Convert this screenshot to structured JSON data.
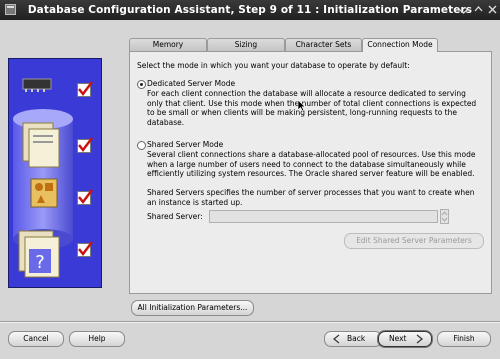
{
  "window": {
    "title": "Database Configuration Assistant, Step 9 of 11 : Initialization Parameters",
    "controls": [
      "minimize",
      "maximize",
      "close"
    ]
  },
  "tabs": [
    {
      "label": "Memory",
      "active": false
    },
    {
      "label": "Sizing",
      "active": false
    },
    {
      "label": "Character Sets",
      "active": false
    },
    {
      "label": "Connection Mode",
      "active": true
    }
  ],
  "content": {
    "intro": "Select the mode in which you want your database to operate by default:",
    "dedicated": {
      "label": "Dedicated Server Mode",
      "selected": true,
      "desc": [
        "For each client connection the database will allocate a resource dedicated to serving",
        "only that client.  Use this mode when the number of total client connections is expected",
        "to be small or when clients will be making persistent, long-running requests to the",
        "database."
      ]
    },
    "shared": {
      "label": "Shared Server Mode",
      "selected": false,
      "desc": [
        "Several client connections share a database-allocated pool of resources.  Use this mode",
        "when a large number of users need to connect to the database simultaneously while",
        "efficiently utilizing system resources.  The Oracle shared server feature will be enabled."
      ]
    },
    "shared_servers_desc": [
      "Shared Servers specifies the number of server processes that you want to create when",
      "an instance is started up."
    ],
    "shared_server_label": "Shared Server:",
    "shared_server_value": "",
    "edit_params_label": "Edit Shared Server Parameters",
    "all_params_label": "All Initialization Parameters..."
  },
  "footer": {
    "cancel": "Cancel",
    "help": "Help",
    "back": "Back",
    "next": "Next",
    "finish": "Finish"
  },
  "colors": {
    "titlebar": "#2a2a2a",
    "panel_blue": "#3a3ad6",
    "check_red": "#cc1111"
  }
}
